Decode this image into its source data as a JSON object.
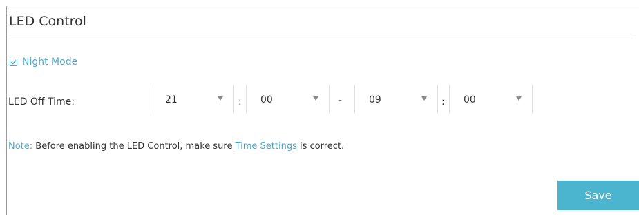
{
  "panel": {
    "title": "LED Control"
  },
  "night_mode": {
    "label": "Night Mode",
    "checked": true
  },
  "led_off_time": {
    "label": "LED Off Time:",
    "start_hour": "21",
    "start_minute": "00",
    "end_hour": "09",
    "end_minute": "00",
    "time_separator": ":",
    "range_separator": "-"
  },
  "note": {
    "prefix": "Note:",
    "text_before": "Before enabling the LED Control, make sure",
    "link": "Time Settings",
    "text_after": "is correct."
  },
  "actions": {
    "save_label": "Save"
  },
  "colors": {
    "accent": "#4ba9c8",
    "save_button": "#4bb5cf"
  }
}
